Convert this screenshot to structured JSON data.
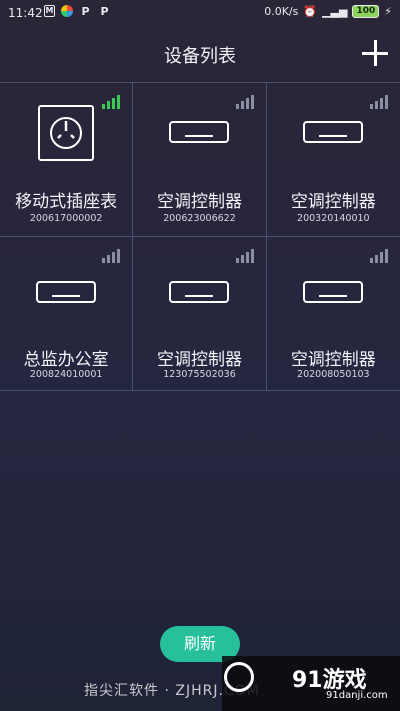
{
  "status_bar": {
    "time": "11:42",
    "speed": "0.0K/s",
    "battery": "100"
  },
  "header": {
    "title": "设备列表"
  },
  "devices": [
    {
      "name": "移动式插座表",
      "id": "200617000002",
      "icon": "socket-icon",
      "signal": "strong"
    },
    {
      "name": "空调控制器",
      "id": "200623006622",
      "icon": "air-conditioner-icon",
      "signal": "weak"
    },
    {
      "name": "空调控制器",
      "id": "200320140010",
      "icon": "air-conditioner-icon",
      "signal": "weak"
    },
    {
      "name": "总监办公室",
      "id": "200824010001",
      "icon": "air-conditioner-icon",
      "signal": "weak"
    },
    {
      "name": "空调控制器",
      "id": "123075502036",
      "icon": "air-conditioner-icon",
      "signal": "weak"
    },
    {
      "name": "空调控制器",
      "id": "202008050103",
      "icon": "air-conditioner-icon",
      "signal": "weak"
    }
  ],
  "refresh_label": "刷新",
  "footer": "指尖汇软件 · ZJHRJ.COM",
  "watermark": {
    "logo": "91游戏",
    "url": "91danji.com"
  },
  "colors": {
    "accent": "#27c09a",
    "signal_strong": "#3cc957",
    "grid_line": "#4a5070"
  }
}
